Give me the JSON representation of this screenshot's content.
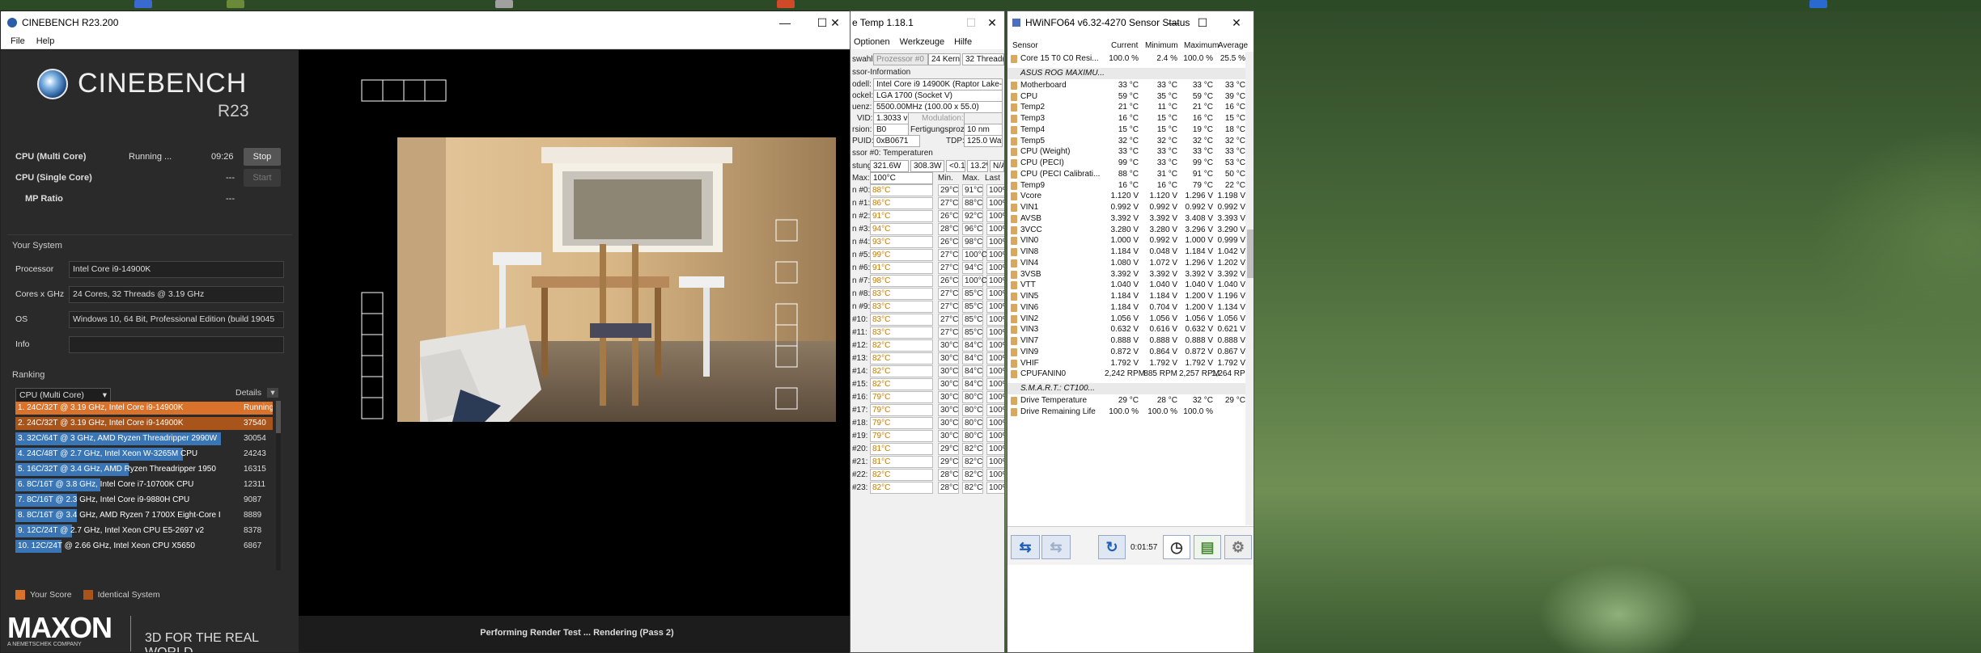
{
  "desktop": {
    "accent": "#3f6236"
  },
  "cinebench": {
    "title": "CINEBENCH R23.200",
    "menu": [
      "File",
      "Help"
    ],
    "logo": "CINEBENCH",
    "logo_sub": "R23",
    "tests": [
      {
        "name": "CPU (Multi Core)",
        "status": "Running ...",
        "time": "09:26",
        "button": "Stop"
      },
      {
        "name": "CPU (Single Core)",
        "status": "",
        "time": "---",
        "button": "Start"
      },
      {
        "name": "MP Ratio",
        "status": "",
        "time": "---",
        "button": ""
      }
    ],
    "your_system_label": "Your System",
    "system": [
      {
        "label": "Processor",
        "value": "Intel Core i9-14900K"
      },
      {
        "label": "Cores x GHz",
        "value": "24 Cores, 32 Threads @ 3.19 GHz"
      },
      {
        "label": "OS",
        "value": "Windows 10, 64 Bit, Professional Edition (build 19045"
      },
      {
        "label": "Info",
        "value": ""
      }
    ],
    "ranking_label": "Ranking",
    "ranking_select": "CPU (Multi Core)",
    "details_label": "Details",
    "ranking": [
      {
        "text": "1. 24C/32T @ 3.19 GHz, Intel Core i9-14900K",
        "score": "Running ...",
        "color": "#d9722a",
        "frac": 1.0
      },
      {
        "text": "2. 24C/32T @ 3.19 GHz, Intel Core i9-14900K",
        "score": "37540",
        "color": "#a9541b",
        "frac": 1.0
      },
      {
        "text": "3. 32C/64T @ 3 GHz, AMD Ryzen Threadripper 2990W",
        "score": "30054",
        "color": "#3a76b5",
        "frac": 0.8
      },
      {
        "text": "4. 24C/48T @ 2.7 GHz, Intel Xeon W-3265M CPU",
        "score": "24243",
        "color": "#3a76b5",
        "frac": 0.65
      },
      {
        "text": "5. 16C/32T @ 3.4 GHz, AMD Ryzen Threadripper 1950",
        "score": "16315",
        "color": "#3a76b5",
        "frac": 0.44
      },
      {
        "text": "6. 8C/16T @ 3.8 GHz, Intel Core i7-10700K CPU",
        "score": "12311",
        "color": "#3a76b5",
        "frac": 0.33
      },
      {
        "text": "7. 8C/16T @ 2.3 GHz, Intel Core i9-9880H CPU",
        "score": "9087",
        "color": "#3a76b5",
        "frac": 0.24
      },
      {
        "text": "8. 8C/16T @ 3.4 GHz, AMD Ryzen 7 1700X Eight-Core I",
        "score": "8889",
        "color": "#3a76b5",
        "frac": 0.24
      },
      {
        "text": "9. 12C/24T @ 2.7 GHz, Intel Xeon CPU E5-2697 v2",
        "score": "8378",
        "color": "#3a76b5",
        "frac": 0.22
      },
      {
        "text": "10. 12C/24T @ 2.66 GHz, Intel Xeon CPU X5650",
        "score": "6867",
        "color": "#3a76b5",
        "frac": 0.18
      }
    ],
    "legend_your": "Your Score",
    "legend_ident": "Identical System",
    "maxon": "MAXON",
    "maxon_sub": "A NEMETSCHEK COMPANY",
    "tagline": "3D FOR THE REAL WORLD",
    "status": "Performing Render Test ... Rendering (Pass 2)"
  },
  "coretemp": {
    "title": "e Temp 1.18.1",
    "menu": [
      "Optionen",
      "Werkzeuge",
      "Hilfe"
    ],
    "select_label": "swahl:",
    "select_value": "Prozessor #0",
    "cores": "24 Kern(e)",
    "threads": "32 Thread(s)",
    "info_label": "ssor-Information",
    "model_label": "odell:",
    "model": "Intel Core i9 14900K (Raptor Lake-S)",
    "socket_label": "ockel:",
    "socket": "LGA 1700 (Socket V)",
    "freq_label": "uenz:",
    "freq": "5500.00MHz (100.00 x 55.0)",
    "vid_label": "VID:",
    "vid": "1.3033 v",
    "mod_label": "Modulation:",
    "rev_label": "rsion:",
    "rev": "B0",
    "fert_label": "Fertigungsprozess:",
    "fert": "10 nm",
    "cpuid_label": "PUID:",
    "cpuid": "0xB0671",
    "tdp_label": "TDP:",
    "tdp": "125.0 Watt",
    "temps_label": "ssor #0: Temperaturen",
    "power_label": "stung",
    "power": [
      "321.6W",
      "308.3W",
      "<0.1W",
      "13.2W",
      "N/A"
    ],
    "tjmax_label": "Max:",
    "tjmax": "100°C",
    "col_min": "Min.",
    "col_max": "Max.",
    "col_last": "Last",
    "cores_list": [
      {
        "n": "n #0:",
        "t": "88°C",
        "min": "29°C",
        "max": "91°C",
        "l": "100%"
      },
      {
        "n": "n #1:",
        "t": "86°C",
        "min": "27°C",
        "max": "88°C",
        "l": "100%"
      },
      {
        "n": "n #2:",
        "t": "91°C",
        "min": "26°C",
        "max": "92°C",
        "l": "100%"
      },
      {
        "n": "n #3:",
        "t": "94°C",
        "min": "28°C",
        "max": "96°C",
        "l": "100%"
      },
      {
        "n": "n #4:",
        "t": "93°C",
        "min": "26°C",
        "max": "98°C",
        "l": "100%"
      },
      {
        "n": "n #5:",
        "t": "99°C",
        "min": "27°C",
        "max": "100°C",
        "l": "100%"
      },
      {
        "n": "n #6:",
        "t": "91°C",
        "min": "27°C",
        "max": "94°C",
        "l": "100%"
      },
      {
        "n": "n #7:",
        "t": "98°C",
        "min": "26°C",
        "max": "100°C",
        "l": "100%"
      },
      {
        "n": "n #8:",
        "t": "83°C",
        "min": "27°C",
        "max": "85°C",
        "l": "100%"
      },
      {
        "n": "n #9:",
        "t": "83°C",
        "min": "27°C",
        "max": "85°C",
        "l": "100%"
      },
      {
        "n": "#10:",
        "t": "83°C",
        "min": "27°C",
        "max": "85°C",
        "l": "100%"
      },
      {
        "n": "#11:",
        "t": "83°C",
        "min": "27°C",
        "max": "85°C",
        "l": "100%"
      },
      {
        "n": "#12:",
        "t": "82°C",
        "min": "30°C",
        "max": "84°C",
        "l": "100%"
      },
      {
        "n": "#13:",
        "t": "82°C",
        "min": "30°C",
        "max": "84°C",
        "l": "100%"
      },
      {
        "n": "#14:",
        "t": "82°C",
        "min": "30°C",
        "max": "84°C",
        "l": "100%"
      },
      {
        "n": "#15:",
        "t": "82°C",
        "min": "30°C",
        "max": "84°C",
        "l": "100%"
      },
      {
        "n": "#16:",
        "t": "79°C",
        "min": "30°C",
        "max": "80°C",
        "l": "100%"
      },
      {
        "n": "#17:",
        "t": "79°C",
        "min": "30°C",
        "max": "80°C",
        "l": "100%"
      },
      {
        "n": "#18:",
        "t": "79°C",
        "min": "30°C",
        "max": "80°C",
        "l": "100%"
      },
      {
        "n": "#19:",
        "t": "79°C",
        "min": "30°C",
        "max": "80°C",
        "l": "100%"
      },
      {
        "n": "#20:",
        "t": "81°C",
        "min": "29°C",
        "max": "82°C",
        "l": "100%"
      },
      {
        "n": "#21:",
        "t": "81°C",
        "min": "29°C",
        "max": "82°C",
        "l": "100%"
      },
      {
        "n": "#22:",
        "t": "82°C",
        "min": "28°C",
        "max": "82°C",
        "l": "100%"
      },
      {
        "n": "#23:",
        "t": "82°C",
        "min": "28°C",
        "max": "82°C",
        "l": "100%"
      }
    ]
  },
  "hwinfo": {
    "title": "HWiNFO64 v6.32-4270 Sensor Status",
    "cols": [
      "Sensor",
      "Current",
      "Minimum",
      "Maximum",
      "Average"
    ],
    "rows": [
      {
        "k": "r",
        "n": "Core 15 T0 C0 Resi...",
        "c": "100.0 %",
        "mi": "2.4 %",
        "ma": "100.0 %",
        "a": "25.5 %"
      },
      {
        "k": "g",
        "n": "ASUS ROG MAXIMU..."
      },
      {
        "k": "r",
        "n": "Motherboard",
        "c": "33 °C",
        "mi": "33 °C",
        "ma": "33 °C",
        "a": "33 °C"
      },
      {
        "k": "r",
        "n": "CPU",
        "c": "59 °C",
        "mi": "35 °C",
        "ma": "59 °C",
        "a": "39 °C"
      },
      {
        "k": "r",
        "n": "Temp2",
        "c": "21 °C",
        "mi": "11 °C",
        "ma": "21 °C",
        "a": "16 °C"
      },
      {
        "k": "r",
        "n": "Temp3",
        "c": "16 °C",
        "mi": "15 °C",
        "ma": "16 °C",
        "a": "15 °C"
      },
      {
        "k": "r",
        "n": "Temp4",
        "c": "15 °C",
        "mi": "15 °C",
        "ma": "19 °C",
        "a": "18 °C"
      },
      {
        "k": "r",
        "n": "Temp5",
        "c": "32 °C",
        "mi": "32 °C",
        "ma": "32 °C",
        "a": "32 °C"
      },
      {
        "k": "r",
        "n": "CPU (Weight)",
        "c": "33 °C",
        "mi": "33 °C",
        "ma": "33 °C",
        "a": "33 °C"
      },
      {
        "k": "r",
        "n": "CPU (PECI)",
        "c": "99 °C",
        "mi": "33 °C",
        "ma": "99 °C",
        "a": "53 °C"
      },
      {
        "k": "r",
        "n": "CPU (PECI Calibrati...",
        "c": "88 °C",
        "mi": "31 °C",
        "ma": "91 °C",
        "a": "50 °C"
      },
      {
        "k": "r",
        "n": "Temp9",
        "c": "16 °C",
        "mi": "16 °C",
        "ma": "79 °C",
        "a": "22 °C"
      },
      {
        "k": "r",
        "n": "Vcore",
        "c": "1.120 V",
        "mi": "1.120 V",
        "ma": "1.296 V",
        "a": "1.198 V"
      },
      {
        "k": "r",
        "n": "VIN1",
        "c": "0.992 V",
        "mi": "0.992 V",
        "ma": "0.992 V",
        "a": "0.992 V"
      },
      {
        "k": "r",
        "n": "AVSB",
        "c": "3.392 V",
        "mi": "3.392 V",
        "ma": "3.408 V",
        "a": "3.393 V"
      },
      {
        "k": "r",
        "n": "3VCC",
        "c": "3.280 V",
        "mi": "3.280 V",
        "ma": "3.296 V",
        "a": "3.290 V"
      },
      {
        "k": "r",
        "n": "VIN0",
        "c": "1.000 V",
        "mi": "0.992 V",
        "ma": "1.000 V",
        "a": "0.999 V"
      },
      {
        "k": "r",
        "n": "VIN8",
        "c": "1.184 V",
        "mi": "0.048 V",
        "ma": "1.184 V",
        "a": "1.042 V"
      },
      {
        "k": "r",
        "n": "VIN4",
        "c": "1.080 V",
        "mi": "1.072 V",
        "ma": "1.296 V",
        "a": "1.202 V"
      },
      {
        "k": "r",
        "n": "3VSB",
        "c": "3.392 V",
        "mi": "3.392 V",
        "ma": "3.392 V",
        "a": "3.392 V"
      },
      {
        "k": "r",
        "n": "VTT",
        "c": "1.040 V",
        "mi": "1.040 V",
        "ma": "1.040 V",
        "a": "1.040 V"
      },
      {
        "k": "r",
        "n": "VIN5",
        "c": "1.184 V",
        "mi": "1.184 V",
        "ma": "1.200 V",
        "a": "1.196 V"
      },
      {
        "k": "r",
        "n": "VIN6",
        "c": "1.184 V",
        "mi": "0.704 V",
        "ma": "1.200 V",
        "a": "1.134 V"
      },
      {
        "k": "r",
        "n": "VIN2",
        "c": "1.056 V",
        "mi": "1.056 V",
        "ma": "1.056 V",
        "a": "1.056 V"
      },
      {
        "k": "r",
        "n": "VIN3",
        "c": "0.632 V",
        "mi": "0.616 V",
        "ma": "0.632 V",
        "a": "0.621 V"
      },
      {
        "k": "r",
        "n": "VIN7",
        "c": "0.888 V",
        "mi": "0.888 V",
        "ma": "0.888 V",
        "a": "0.888 V"
      },
      {
        "k": "r",
        "n": "VIN9",
        "c": "0.872 V",
        "mi": "0.864 V",
        "ma": "0.872 V",
        "a": "0.867 V"
      },
      {
        "k": "r",
        "n": "VHIF",
        "c": "1.792 V",
        "mi": "1.792 V",
        "ma": "1.792 V",
        "a": "1.792 V"
      },
      {
        "k": "r",
        "n": "CPUFANIN0",
        "c": "2,242 RPM",
        "mi": "885 RPM",
        "ma": "2,257 RPM",
        "a": "1,264 RPM"
      },
      {
        "k": "g",
        "n": "S.M.A.R.T.: CT100..."
      },
      {
        "k": "r",
        "n": "Drive Temperature",
        "c": "29 °C",
        "mi": "28 °C",
        "ma": "32 °C",
        "a": "29 °C"
      },
      {
        "k": "r",
        "n": "Drive Remaining Life",
        "c": "100.0 %",
        "mi": "100.0 %",
        "ma": "100.0 %",
        "a": ""
      }
    ],
    "timer": "0:01:57"
  }
}
